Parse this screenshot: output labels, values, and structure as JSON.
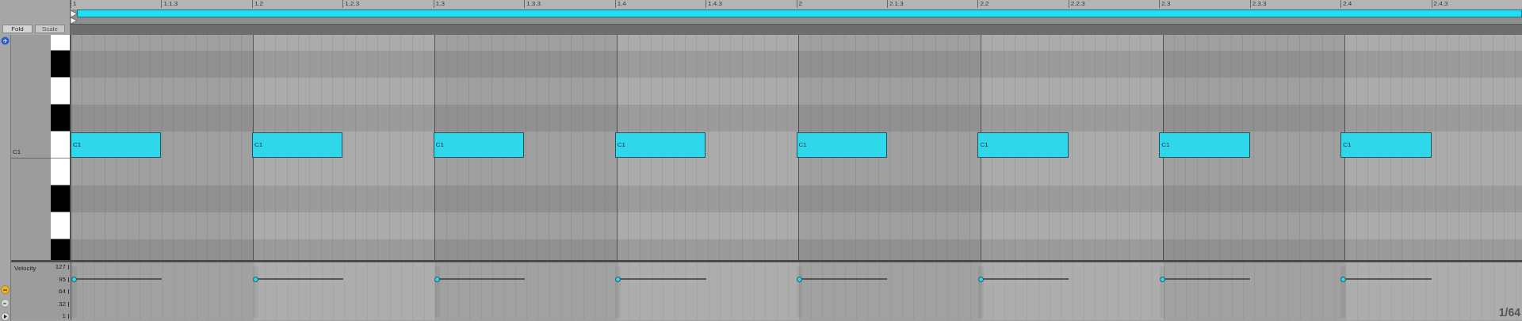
{
  "ruler": {
    "labels": [
      "1",
      "1.1.3",
      "1.2",
      "1.2.3",
      "1.3",
      "1.3.3",
      "1.4",
      "1.4.3",
      "2",
      "2.1.3",
      "2.2",
      "2.2.3",
      "2.3",
      "2.3.3",
      "2.4",
      "2.4.3"
    ]
  },
  "toolbar_buttons": [
    {
      "label": "Fold",
      "disabled": false
    },
    {
      "label": "Scale",
      "disabled": true
    }
  ],
  "keys": [
    {
      "kind": "white"
    },
    {
      "kind": "black"
    },
    {
      "kind": "white"
    },
    {
      "kind": "black"
    },
    {
      "kind": "white",
      "label": "C1"
    },
    {
      "kind": "white"
    },
    {
      "kind": "black"
    },
    {
      "kind": "white"
    },
    {
      "kind": "black"
    }
  ],
  "notes": [
    {
      "label": "C1"
    },
    {
      "label": "C1"
    },
    {
      "label": "C1"
    },
    {
      "label": "C1"
    },
    {
      "label": "C1"
    },
    {
      "label": "C1"
    },
    {
      "label": "C1"
    },
    {
      "label": "C1"
    }
  ],
  "velocity": {
    "label": "Velocity",
    "scale": [
      "127",
      "95",
      "64",
      "32",
      "1"
    ],
    "notes": [
      {
        "level": 0.75
      },
      {
        "level": 0.75
      },
      {
        "level": 0.75
      },
      {
        "level": 0.75
      },
      {
        "level": 0.75
      },
      {
        "level": 0.75
      },
      {
        "level": 0.75
      },
      {
        "level": 0.75
      }
    ]
  },
  "grid_label": "1/64"
}
